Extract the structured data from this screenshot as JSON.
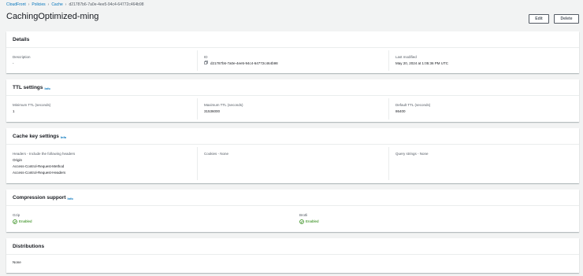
{
  "breadcrumb": [
    "CloudFront",
    "Policies",
    "Cache",
    "d21787b6-7a0e-4ee5-94c4-64772c464b98"
  ],
  "page_title": "CachingOptimized-ming",
  "actions": {
    "edit": "Edit",
    "delete": "Delete"
  },
  "details": {
    "title": "Details",
    "description_label": "Description",
    "description_value": "-",
    "id_label": "ID",
    "id_value": "d21787b6-7a0e-4ee5-94c4-64772c464b98",
    "last_modified_label": "Last modified",
    "last_modified_value": "May 20, 2024 at 1:05:36 PM UTC"
  },
  "ttl": {
    "title": "TTL settings",
    "info": "Info",
    "min_label": "Minimum TTL (seconds)",
    "min_value": "1",
    "max_label": "Maximum TTL (seconds)",
    "max_value": "31536000",
    "default_label": "Default TTL (seconds)",
    "default_value": "86400"
  },
  "cache_key": {
    "title": "Cache key settings",
    "info": "Info",
    "headers_label": "Headers - Include the following headers",
    "headers": [
      "Origin",
      "Access-Control-Request-Method",
      "Access-Control-Request-Headers"
    ],
    "cookies_label": "Cookies - None",
    "query_label": "Query strings - None"
  },
  "compression": {
    "title": "Compression support",
    "info": "Info",
    "gzip_label": "Gzip",
    "gzip_value": "Enabled",
    "brotli_label": "Brotli",
    "brotli_value": "Enabled",
    "status_color": "#1d8102"
  },
  "distributions": {
    "title": "Distributions",
    "value": "None"
  }
}
